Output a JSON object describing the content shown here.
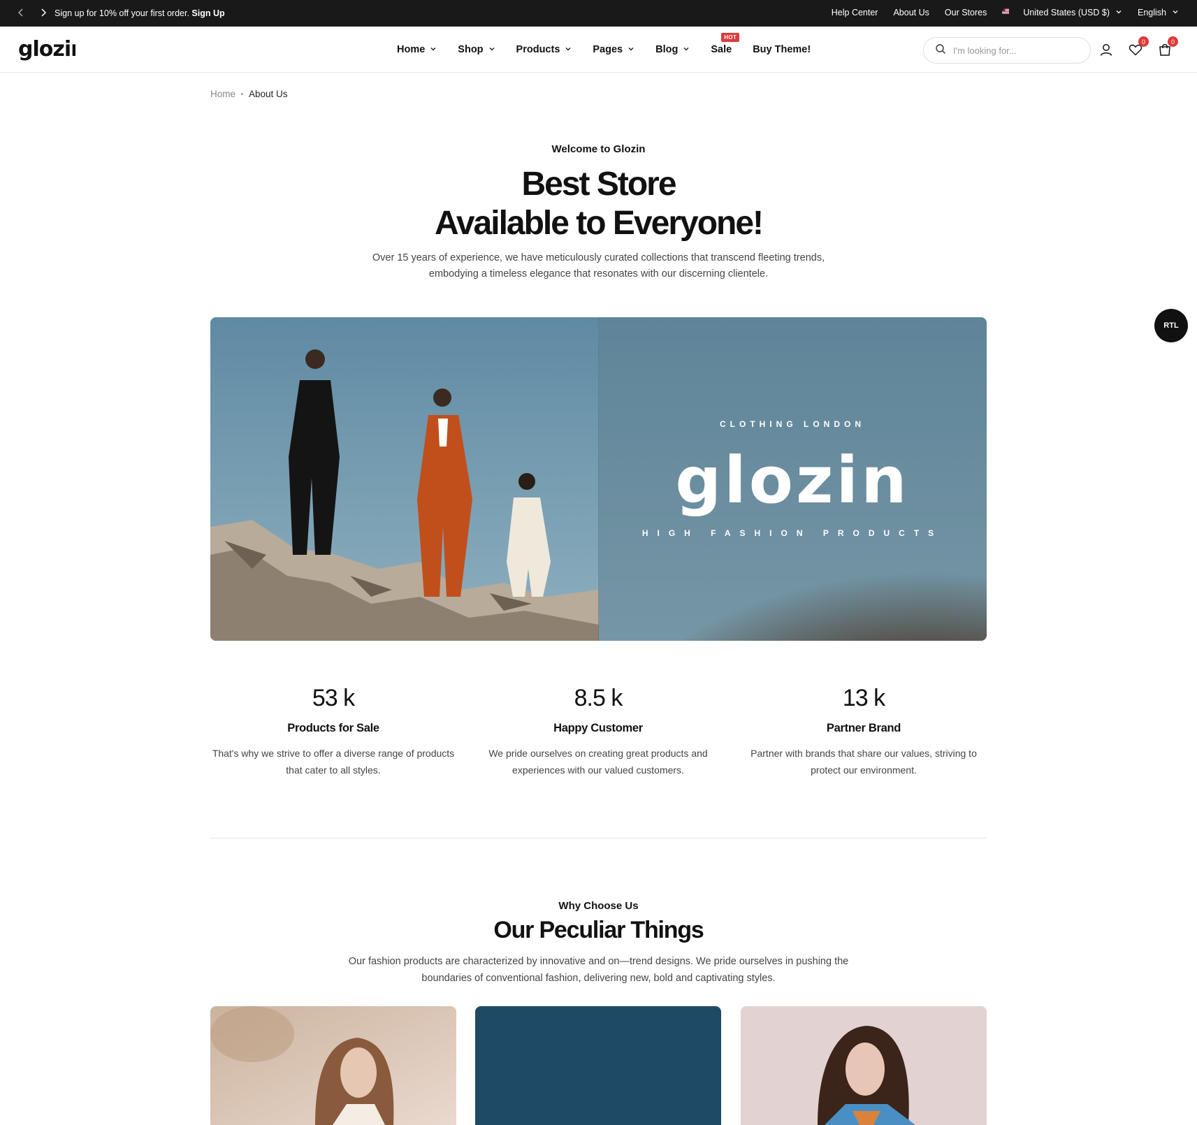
{
  "topbar": {
    "promo_text": "Sign up for 10% off your first order.",
    "promo_link": "Sign Up",
    "links": [
      "Help Center",
      "About Us",
      "Our Stores"
    ],
    "currency": "United States (USD $)",
    "language": "English"
  },
  "header": {
    "logo": "glozin",
    "nav": [
      {
        "label": "Home"
      },
      {
        "label": "Shop"
      },
      {
        "label": "Products"
      },
      {
        "label": "Pages"
      },
      {
        "label": "Blog"
      },
      {
        "label": "Sale"
      },
      {
        "label": "Buy Theme!"
      }
    ],
    "hot_badge": "HOT",
    "search_placeholder": "I'm looking for...",
    "wishlist_count": "0",
    "cart_count": "0"
  },
  "breadcrumb": {
    "home": "Home",
    "current": "About Us"
  },
  "hero": {
    "eyebrow": "Welcome to Glozin",
    "title_line1": "Best Store",
    "title_line2": "Available to Everyone!",
    "intro_line1": "Over 15 years of experience, we have meticulously curated collections that transcend fleeting trends,",
    "intro_line2": "embodying a timeless elegance that resonates with our discerning clientele."
  },
  "banner": {
    "small": "CLOTHING LONDON",
    "logo": "glozin",
    "sub": "HIGH FASHION PRODUCTS"
  },
  "rtl_button": "RTL",
  "stats": [
    {
      "value": "53 k",
      "title": "Products for Sale",
      "desc1": "That's why we strive to offer a diverse range of products",
      "desc2": "that cater to all styles."
    },
    {
      "value": "8.5 k",
      "title": "Happy Customer",
      "desc1": "We pride ourselves on creating great products and",
      "desc2": "experiences with our valued customers."
    },
    {
      "value": "13 k",
      "title": "Partner Brand",
      "desc1": "Partner with brands that share our values, striving to",
      "desc2": "protect our environment."
    }
  ],
  "why": {
    "eyebrow": "Why Choose Us",
    "title": "Our Peculiar Things",
    "desc1": "Our fashion products are characterized by innovative and on—trend designs. We pride ourselves in pushing the",
    "desc2": "boundaries of conventional fashion, delivering new, bold and captivating styles."
  },
  "colors": {
    "topbar_bg": "#191919",
    "accent_red": "#e03a3a",
    "banner_sky": "#6f97ad",
    "card_blue": "#1f4a66"
  }
}
